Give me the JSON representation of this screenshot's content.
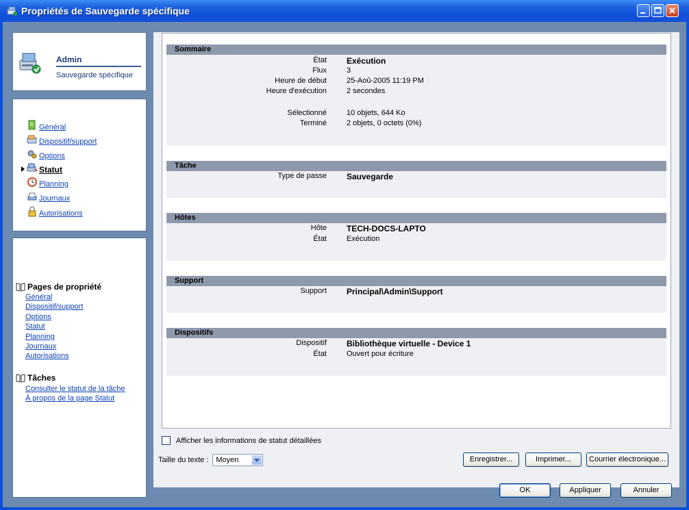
{
  "window": {
    "title": "Propriétés de Sauvegarde spécifique"
  },
  "header": {
    "name": "Admin",
    "subtitle": "Sauvegarde spécifique"
  },
  "nav": {
    "items": [
      {
        "label": "Général",
        "icon": "page-icon"
      },
      {
        "label": "Dispositif/support",
        "icon": "device-icon"
      },
      {
        "label": "Options",
        "icon": "options-icon"
      },
      {
        "label": "Statut",
        "icon": "status-icon",
        "active": true
      },
      {
        "label": "Planning",
        "icon": "clock-icon"
      },
      {
        "label": "Journaux",
        "icon": "log-icon"
      },
      {
        "label": "Autorisations",
        "icon": "lock-icon"
      }
    ]
  },
  "sidebar_links": {
    "property_pages_title": "Pages de propriété",
    "property_pages": [
      "Général",
      "Dispositif/support",
      "Options",
      "Statut",
      "Planning",
      "Journaux",
      "Autorisations"
    ],
    "tasks_title": "Tâches",
    "tasks": [
      "Consulter le statut de la tâche",
      "À propos de la page Statut"
    ]
  },
  "sections": {
    "summary": {
      "title": "Sommaire",
      "rows": [
        {
          "label": "État",
          "value": "Exécution"
        },
        {
          "label": "Flux",
          "value": "3"
        },
        {
          "label": "Heure de début",
          "value": "25-Aoû-2005 11:19 PM"
        },
        {
          "label": "Heure d'exécution",
          "value": "2 secondes"
        },
        {
          "label": "Sélectionné",
          "value": "10 objets, 644 Ko"
        },
        {
          "label": "Terminé",
          "value": "2 objets, 0 octets (0%)"
        }
      ]
    },
    "task": {
      "title": "Tâche",
      "rows": [
        {
          "label": "Type de passe",
          "value": "Sauvegarde"
        }
      ]
    },
    "hosts": {
      "title": "Hôtes",
      "rows": [
        {
          "label": "Hôte",
          "value": "TECH-DOCS-LAPTO"
        },
        {
          "label": "État",
          "value": "Exécution"
        }
      ]
    },
    "media": {
      "title": "Support",
      "rows": [
        {
          "label": "Support",
          "value": "Principal\\Admin\\Support"
        }
      ]
    },
    "devices": {
      "title": "Dispositifs",
      "rows": [
        {
          "label": "Dispositif",
          "value": "Bibliothèque virtuelle - Device 1"
        },
        {
          "label": "État",
          "value": "Ouvert pour écriture"
        }
      ]
    }
  },
  "options": {
    "detail_checkbox": "Afficher les informations de statut détaillées",
    "text_size_label": "Taille du texte :",
    "text_size_value": "Moyen"
  },
  "buttons": {
    "save": "Enregistrer...",
    "print": "Imprimer...",
    "email": "Courrier électronique...",
    "ok": "OK",
    "apply": "Appliquer",
    "cancel": "Annuler"
  }
}
